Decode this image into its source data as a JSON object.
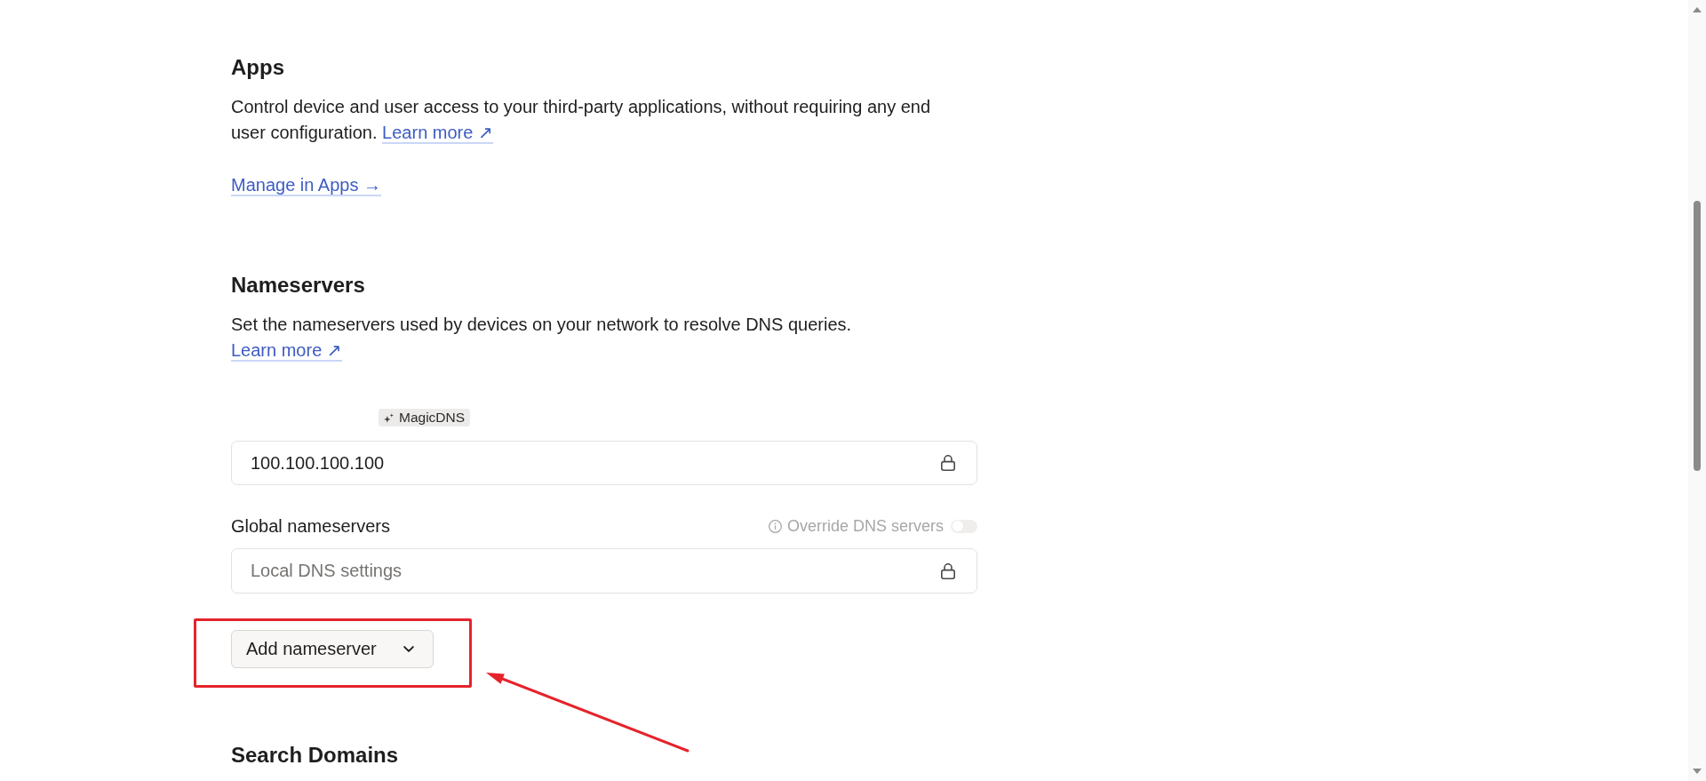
{
  "apps": {
    "title": "Apps",
    "description": "Control device and user access to your third-party applications, without requiring any end user configuration.",
    "learn_more": "Learn more ↗",
    "manage_link": "Manage in Apps →"
  },
  "nameservers": {
    "title": "Nameservers",
    "description": "Set the nameservers used by devices on your network to resolve DNS queries.",
    "learn_more": "Learn more ↗",
    "magicdns": {
      "badge": "MagicDNS",
      "field": {
        "value": "100.100.100.100",
        "locked": true
      }
    },
    "global": {
      "label": "Global nameservers",
      "override": {
        "label": "Override DNS servers",
        "on": false,
        "disabled": true
      },
      "field": {
        "placeholder": "Local DNS settings",
        "locked": true
      }
    },
    "add_button": {
      "label": "Add nameserver",
      "highlighted": true
    }
  },
  "search_domains": {
    "title": "Search Domains"
  }
}
